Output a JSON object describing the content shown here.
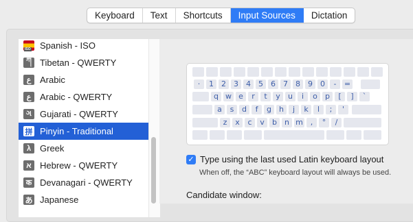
{
  "tabs": [
    {
      "label": "Keyboard",
      "active": false
    },
    {
      "label": "Text",
      "active": false
    },
    {
      "label": "Shortcuts",
      "active": false
    },
    {
      "label": "Input Sources",
      "active": true
    },
    {
      "label": "Dictation",
      "active": false
    }
  ],
  "sources": [
    {
      "label": "Spanish - ISO",
      "icon": "spain-flag-icon",
      "glyph": ""
    },
    {
      "label": "Tibetan - QWERTY",
      "icon": "tibetan-script-icon",
      "glyph": "ཀ"
    },
    {
      "label": "Arabic",
      "icon": "arabic-script-icon",
      "glyph": "ع"
    },
    {
      "label": "Arabic - QWERTY",
      "icon": "arabic-script-icon",
      "glyph": "ع"
    },
    {
      "label": "Gujarati - QWERTY",
      "icon": "gujarati-script-icon",
      "glyph": "ગ"
    },
    {
      "label": "Pinyin - Traditional",
      "icon": "pinyin-grid-icon",
      "glyph": "拼",
      "selected": true
    },
    {
      "label": "Greek",
      "icon": "greek-script-icon",
      "glyph": "λ"
    },
    {
      "label": "Hebrew - QWERTY",
      "icon": "hebrew-script-icon",
      "glyph": "א"
    },
    {
      "label": "Devanagari - QWERTY",
      "icon": "devanagari-script-icon",
      "glyph": "क"
    },
    {
      "label": "Japanese",
      "icon": "japanese-script-icon",
      "glyph": "あ"
    }
  ],
  "keyboard": {
    "rows": [
      [
        "·",
        "1",
        "2",
        "3",
        "4",
        "5",
        "6",
        "7",
        "8",
        "9",
        "0",
        "-",
        "="
      ],
      [
        "q",
        "w",
        "e",
        "r",
        "t",
        "y",
        "u",
        "i",
        "o",
        "p",
        "[",
        "]",
        "`"
      ],
      [
        "a",
        "s",
        "d",
        "f",
        "g",
        "h",
        "j",
        "k",
        "l",
        ";",
        "'"
      ],
      [
        "z",
        "x",
        "c",
        "v",
        "b",
        "n",
        "m",
        ",",
        "°",
        "/"
      ]
    ]
  },
  "options": {
    "last_latin_label": "Type using the last used Latin keyboard layout",
    "last_latin_checked": true,
    "last_latin_note": "When off, the “ABC” keyboard layout will always be used.",
    "candidate_window_label": "Candidate window:"
  },
  "colors": {
    "accent": "#2f7cf6",
    "selection": "#2360d6",
    "key_text": "#3c5da8"
  }
}
